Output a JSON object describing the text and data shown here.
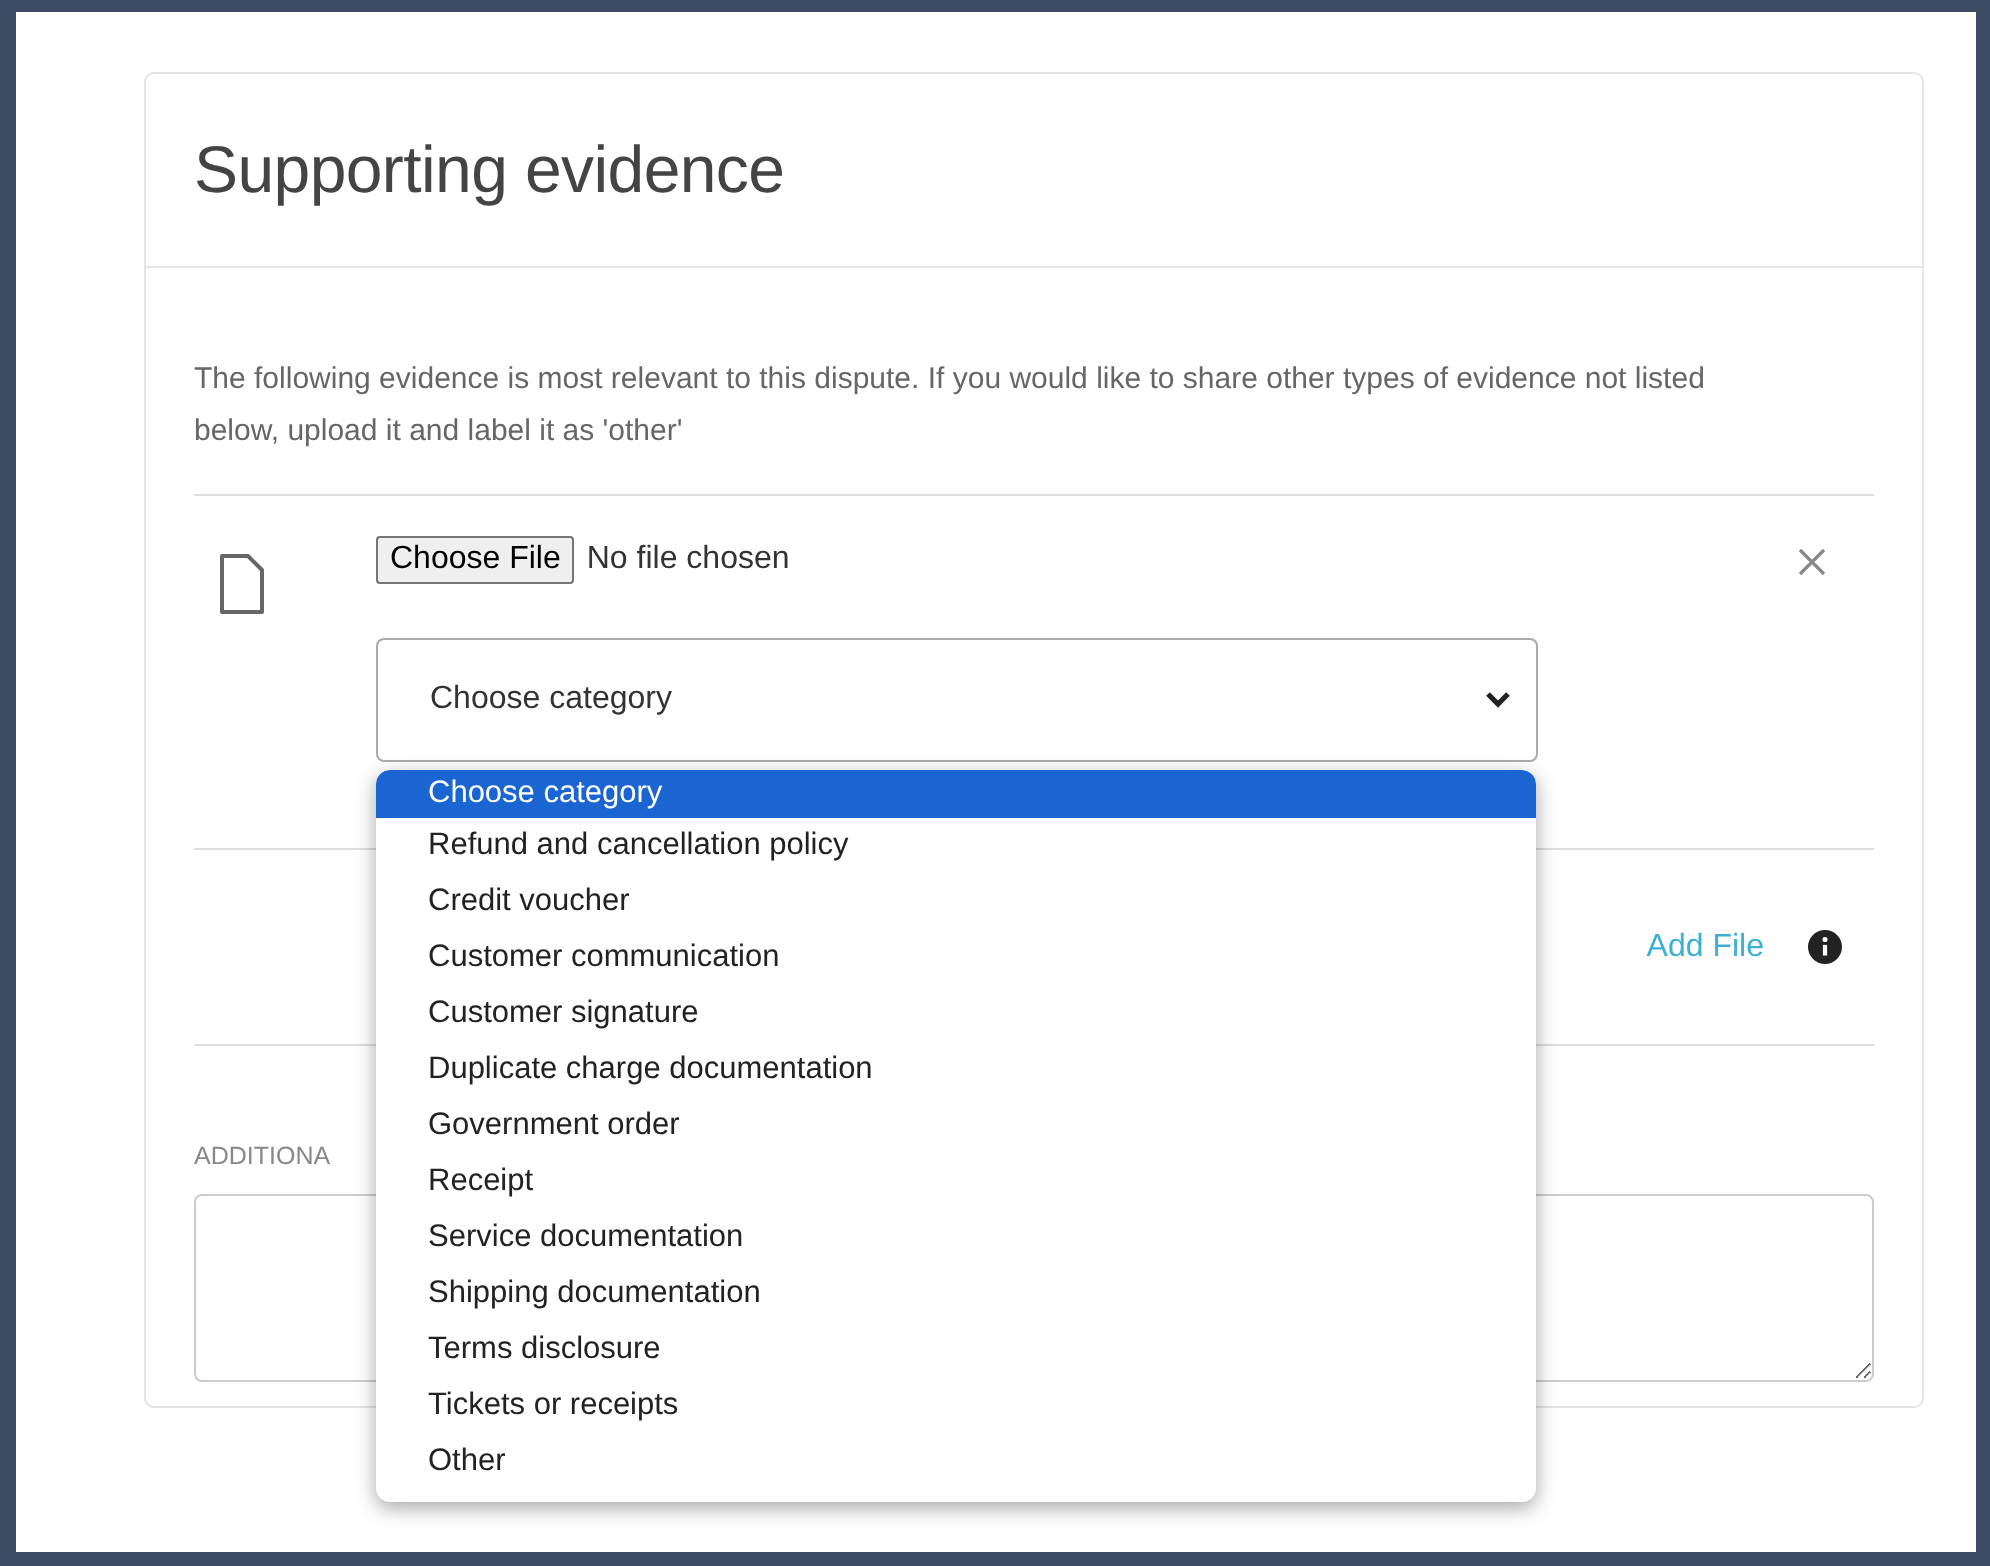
{
  "card": {
    "title": "Supporting evidence",
    "description": "The following evidence is most relevant to this dispute. If you would like to share other types of evidence not listed below, upload it and label it as 'other'",
    "file_row": {
      "choose_button": "Choose File",
      "file_status": "No file chosen",
      "category_select": {
        "value": "Choose category",
        "open": true,
        "options": [
          {
            "label": "Choose category",
            "selected": true
          },
          {
            "label": "Refund and cancellation policy",
            "selected": false
          },
          {
            "label": "Credit voucher",
            "selected": false
          },
          {
            "label": "Customer communication",
            "selected": false
          },
          {
            "label": "Customer signature",
            "selected": false
          },
          {
            "label": "Duplicate charge documentation",
            "selected": false
          },
          {
            "label": "Government order",
            "selected": false
          },
          {
            "label": "Receipt",
            "selected": false
          },
          {
            "label": "Service documentation",
            "selected": false
          },
          {
            "label": "Shipping documentation",
            "selected": false
          },
          {
            "label": "Terms disclosure",
            "selected": false
          },
          {
            "label": "Tickets or receipts",
            "selected": false
          },
          {
            "label": "Other",
            "selected": false
          }
        ]
      }
    },
    "add_file": "Add File",
    "additional_label": "ADDITIONA"
  }
}
